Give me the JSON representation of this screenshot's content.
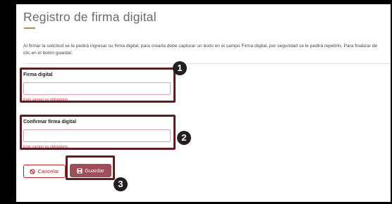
{
  "page": {
    "title": "Registro de firma digital",
    "instructions": "Al firmar la solicitud se le pedirá ingresar su firma digital, para crearla debe capturar un texto en el campo Firma digital, por seguridad se le pedirá repetirlo. Para finalizar dé clic en el botón guardar."
  },
  "form": {
    "signature": {
      "label": "Firma digital",
      "value": "",
      "error": "Este campo es obligatorio."
    },
    "confirm_signature": {
      "label": "Confirmar firma digital",
      "value": "",
      "error": "Este campo es obligatorio."
    }
  },
  "actions": {
    "cancel_label": "Cancelar",
    "save_label": "Guardar",
    "cancel_icon": "ban-icon",
    "save_icon": "floppy-disk-icon"
  },
  "callouts": [
    "1",
    "2",
    "3"
  ],
  "colors": {
    "accent_gold": "#b38e5d",
    "guinda": "#9f4d59",
    "error": "#d6334a",
    "highlight_border": "#5a1f24"
  }
}
